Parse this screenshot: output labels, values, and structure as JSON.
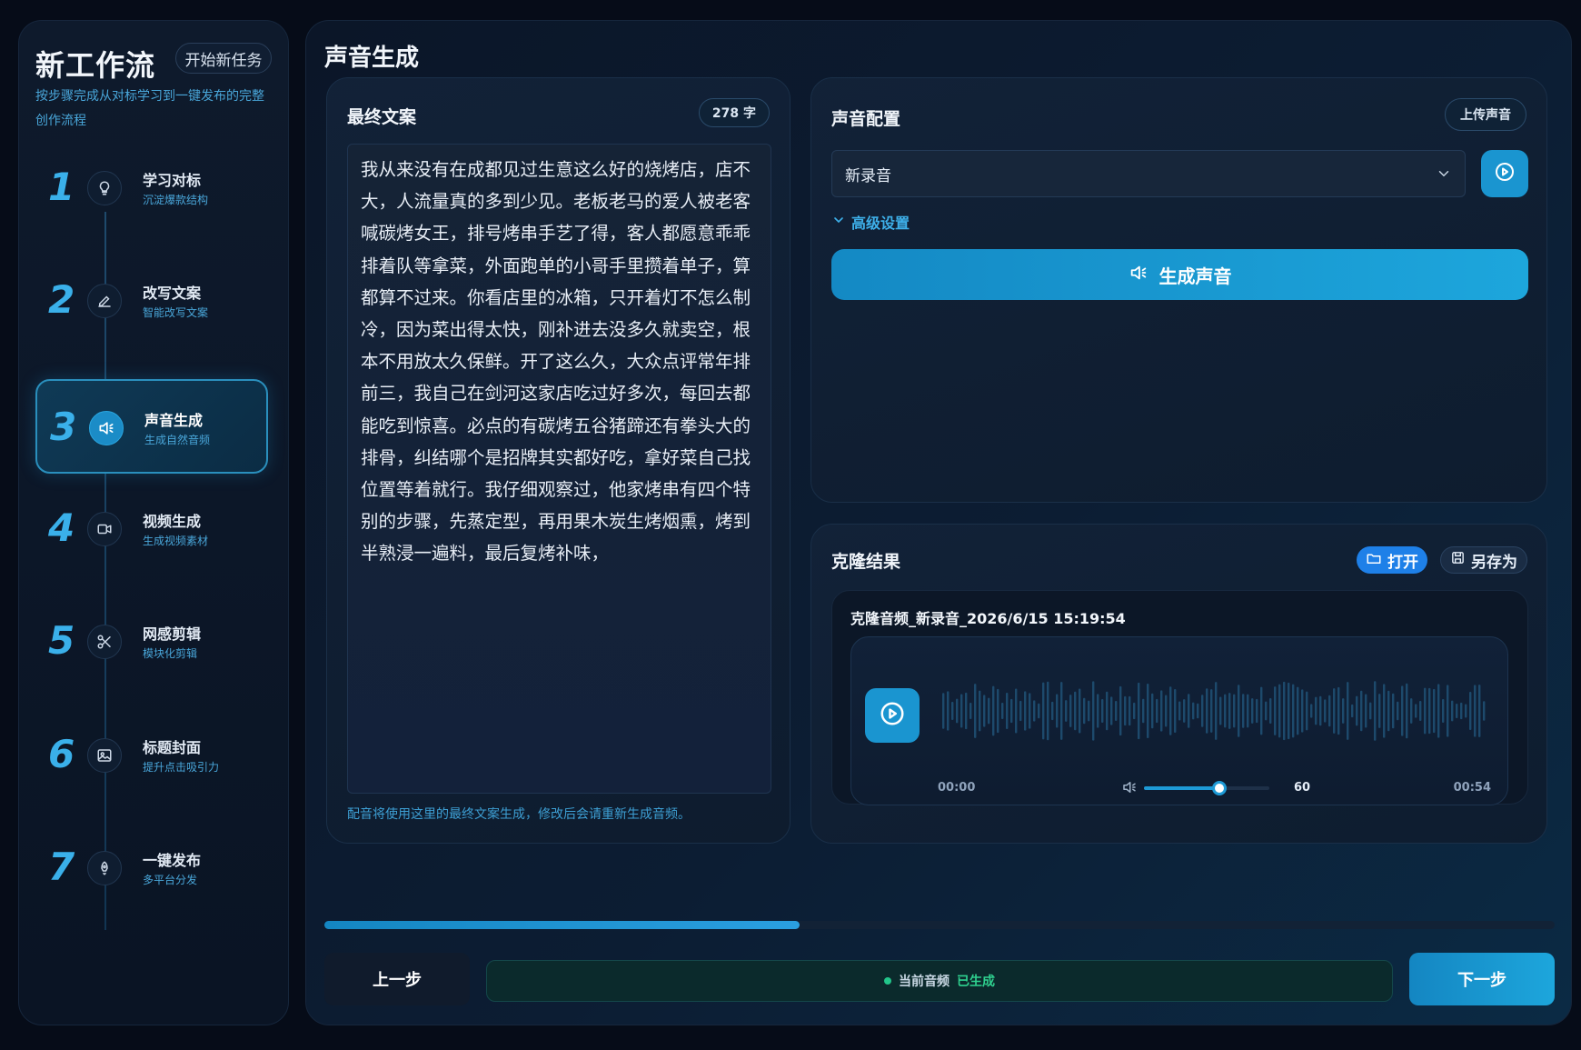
{
  "sidebar": {
    "title": "新工作流",
    "new_task": "开始新任务",
    "description": "按步骤完成从对标学习到一键发布的完整创作流程",
    "steps": [
      {
        "num": "1",
        "label": "学习对标",
        "sub": "沉淀爆款结构",
        "icon": "lightbulb-icon"
      },
      {
        "num": "2",
        "label": "改写文案",
        "sub": "智能改写文案",
        "icon": "pencil-icon"
      },
      {
        "num": "3",
        "label": "声音生成",
        "sub": "生成自然音频",
        "icon": "speaker-icon",
        "active": true
      },
      {
        "num": "4",
        "label": "视频生成",
        "sub": "生成视频素材",
        "icon": "video-icon"
      },
      {
        "num": "5",
        "label": "网感剪辑",
        "sub": "模块化剪辑",
        "icon": "scissors-icon"
      },
      {
        "num": "6",
        "label": "标题封面",
        "sub": "提升点击吸引力",
        "icon": "image-icon"
      },
      {
        "num": "7",
        "label": "一键发布",
        "sub": "多平台分发",
        "icon": "rocket-icon"
      }
    ]
  },
  "main": {
    "title": "声音生成",
    "script": {
      "title": "最终文案",
      "word_count": "278 字",
      "text": "我从来没有在成都见过生意这么好的烧烤店，店不大，人流量真的多到少见。老板老马的爱人被老客喊碳烤女王，排号烤串手艺了得，客人都愿意乖乖排着队等拿菜，外面跑单的小哥手里攒着单子，算都算不过来。你看店里的冰箱，只开着灯不怎么制冷，因为菜出得太快，刚补进去没多久就卖空，根本不用放太久保鲜。开了这么久，大众点评常年排前三，我自己在剑河这家店吃过好多次，每回去都能吃到惊喜。必点的有碳烤五谷猪蹄还有拳头大的排骨，纠结哪个是招牌其实都好吃，拿好菜自己找位置等着就行。我仔细观察过，他家烤串有四个特别的步骤，先蒸定型，再用果木炭生烤烟熏，烤到半熟浸一遍料，最后复烤补味，",
      "note": "配音将使用这里的最终文案生成，修改后会请重新生成音频。"
    },
    "voice": {
      "title": "声音配置",
      "upload": "上传声音",
      "selected": "新录音",
      "advanced": "高级设置",
      "generate": "生成声音"
    },
    "clone": {
      "title": "克隆结果",
      "open": "打开",
      "save_as": "另存为",
      "audio_name": "克隆音频_新录音_2026/6/15 15:19:54",
      "time_start": "00:00",
      "time_end": "00:54",
      "volume": "60",
      "volume_fraction": 0.6
    },
    "progress_fraction": 0.386,
    "prev": "上一步",
    "next": "下一步",
    "status": {
      "label": "当前音频",
      "value": "已生成"
    }
  },
  "colors": {
    "accent": "#1a95d0",
    "status_ok": "#2fd18f",
    "open_btn": "#1e80e8"
  }
}
